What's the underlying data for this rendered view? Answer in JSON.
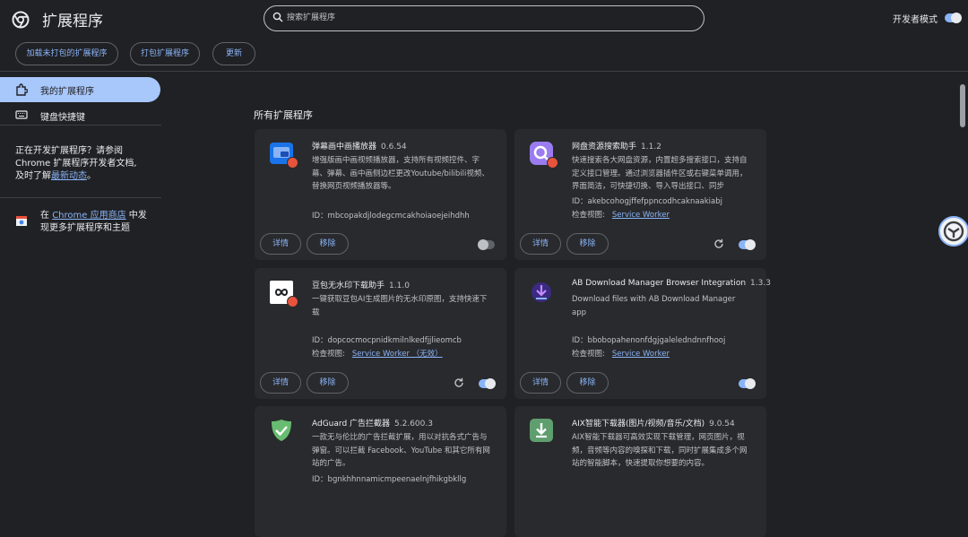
{
  "app": {
    "title": "扩展程序"
  },
  "search": {
    "placeholder": "搜索扩展程序"
  },
  "developer_mode": {
    "label": "开发者模式",
    "enabled": true
  },
  "toolbar": {
    "load_unpacked": "加载未打包的扩展程序",
    "pack": "打包扩展程序",
    "update": "更新"
  },
  "sidebar": {
    "items": [
      {
        "label": "我的扩展程序",
        "icon": "extension-icon",
        "active": true
      },
      {
        "label": "键盘快捷键",
        "icon": "keyboard-icon",
        "active": false
      }
    ],
    "dev_notice": {
      "line1": "正在开发扩展程序？请参阅",
      "line2": "Chrome 扩展程序开发者文档,",
      "line3_prefix": "及时了解",
      "line3_link": "最新动态",
      "line3_suffix": "。"
    },
    "store": {
      "prefix": "在 ",
      "link": "Chrome 应用商店",
      "suffix": " 中发",
      "line2": "现更多扩展程序和主题"
    }
  },
  "main": {
    "section_title": "所有扩展程序"
  },
  "common": {
    "details_label": "详情",
    "remove_label": "移除",
    "views_label": "检查视图:"
  },
  "extensions": [
    {
      "name": "弹幕画中画播放器",
      "version": "0.6.54",
      "description": "增强版画中画视频播放器，支持所有视频控件、字幕、弹幕、画中画侧边栏更改Youtube/bilibili视频、替换网页视频播放器等。",
      "id_text": "ID：mbcopakdjlodegcmcakhoiaoejeihdhh",
      "views_link": "",
      "enabled": false,
      "reload": false,
      "icon": "pip-player-icon"
    },
    {
      "name": "网盘资源搜索助手",
      "version": "1.1.2",
      "description": "快速搜索各大网盘资源，内置超多搜索接口，支持自定义接口管理。通过浏览器插件区或右键菜单调用，界面简洁，可快捷切换、导入导出接口、同步",
      "id_text": "ID：akebcohogjffefppncodhcaknaakiabj",
      "views_link": "Service Worker",
      "enabled": true,
      "reload": true,
      "icon": "search-helper-icon"
    },
    {
      "name": "豆包无水印下载助手",
      "version": "1.1.0",
      "description": "一键获取豆包AI生成图片的无水印原图，支持快速下载",
      "id_text": "ID：dopcocmocpnidkmilnlkedfjjlieomcb",
      "views_link": "Service Worker （无效）",
      "enabled": true,
      "reload": true,
      "icon": "doubao-icon"
    },
    {
      "name": "AB Download Manager Browser Integration",
      "version": "1.3.3",
      "description": "Download files with AB Download Manager app",
      "id_text": "ID：bbobopahenonfdgjgaleledndnnfhooj",
      "views_link": "Service Worker",
      "enabled": true,
      "reload": false,
      "icon": "ab-download-icon"
    },
    {
      "name": "AdGuard 广告拦截器",
      "version": "5.2.600.3",
      "description": "一款无与伦比的广告拦截扩展，用以对抗各式广告与弹窗。可以拦截 Facebook、YouTube 和其它所有网站的广告。",
      "id_text": "ID：bgnkhhnnamicmpeenaelnjfhikgbkllg",
      "views_link": "",
      "enabled": true,
      "reload": false,
      "icon": "adguard-icon"
    },
    {
      "name": "AIX智能下载器(图片/视频/音乐/文档)",
      "version": "9.0.54",
      "description": "AIX智能下载器可高效实现下载管理，网页图片，视频，音频等内容的嗅探和下载，同时扩展集成多个网站的智能脚本，快速提取你想要的内容。",
      "id_text": "",
      "views_link": "",
      "enabled": true,
      "reload": false,
      "icon": "aix-download-icon"
    }
  ],
  "colors": {
    "accent": "#8ab4f8",
    "background": "#202124",
    "card": "#292a2d"
  }
}
